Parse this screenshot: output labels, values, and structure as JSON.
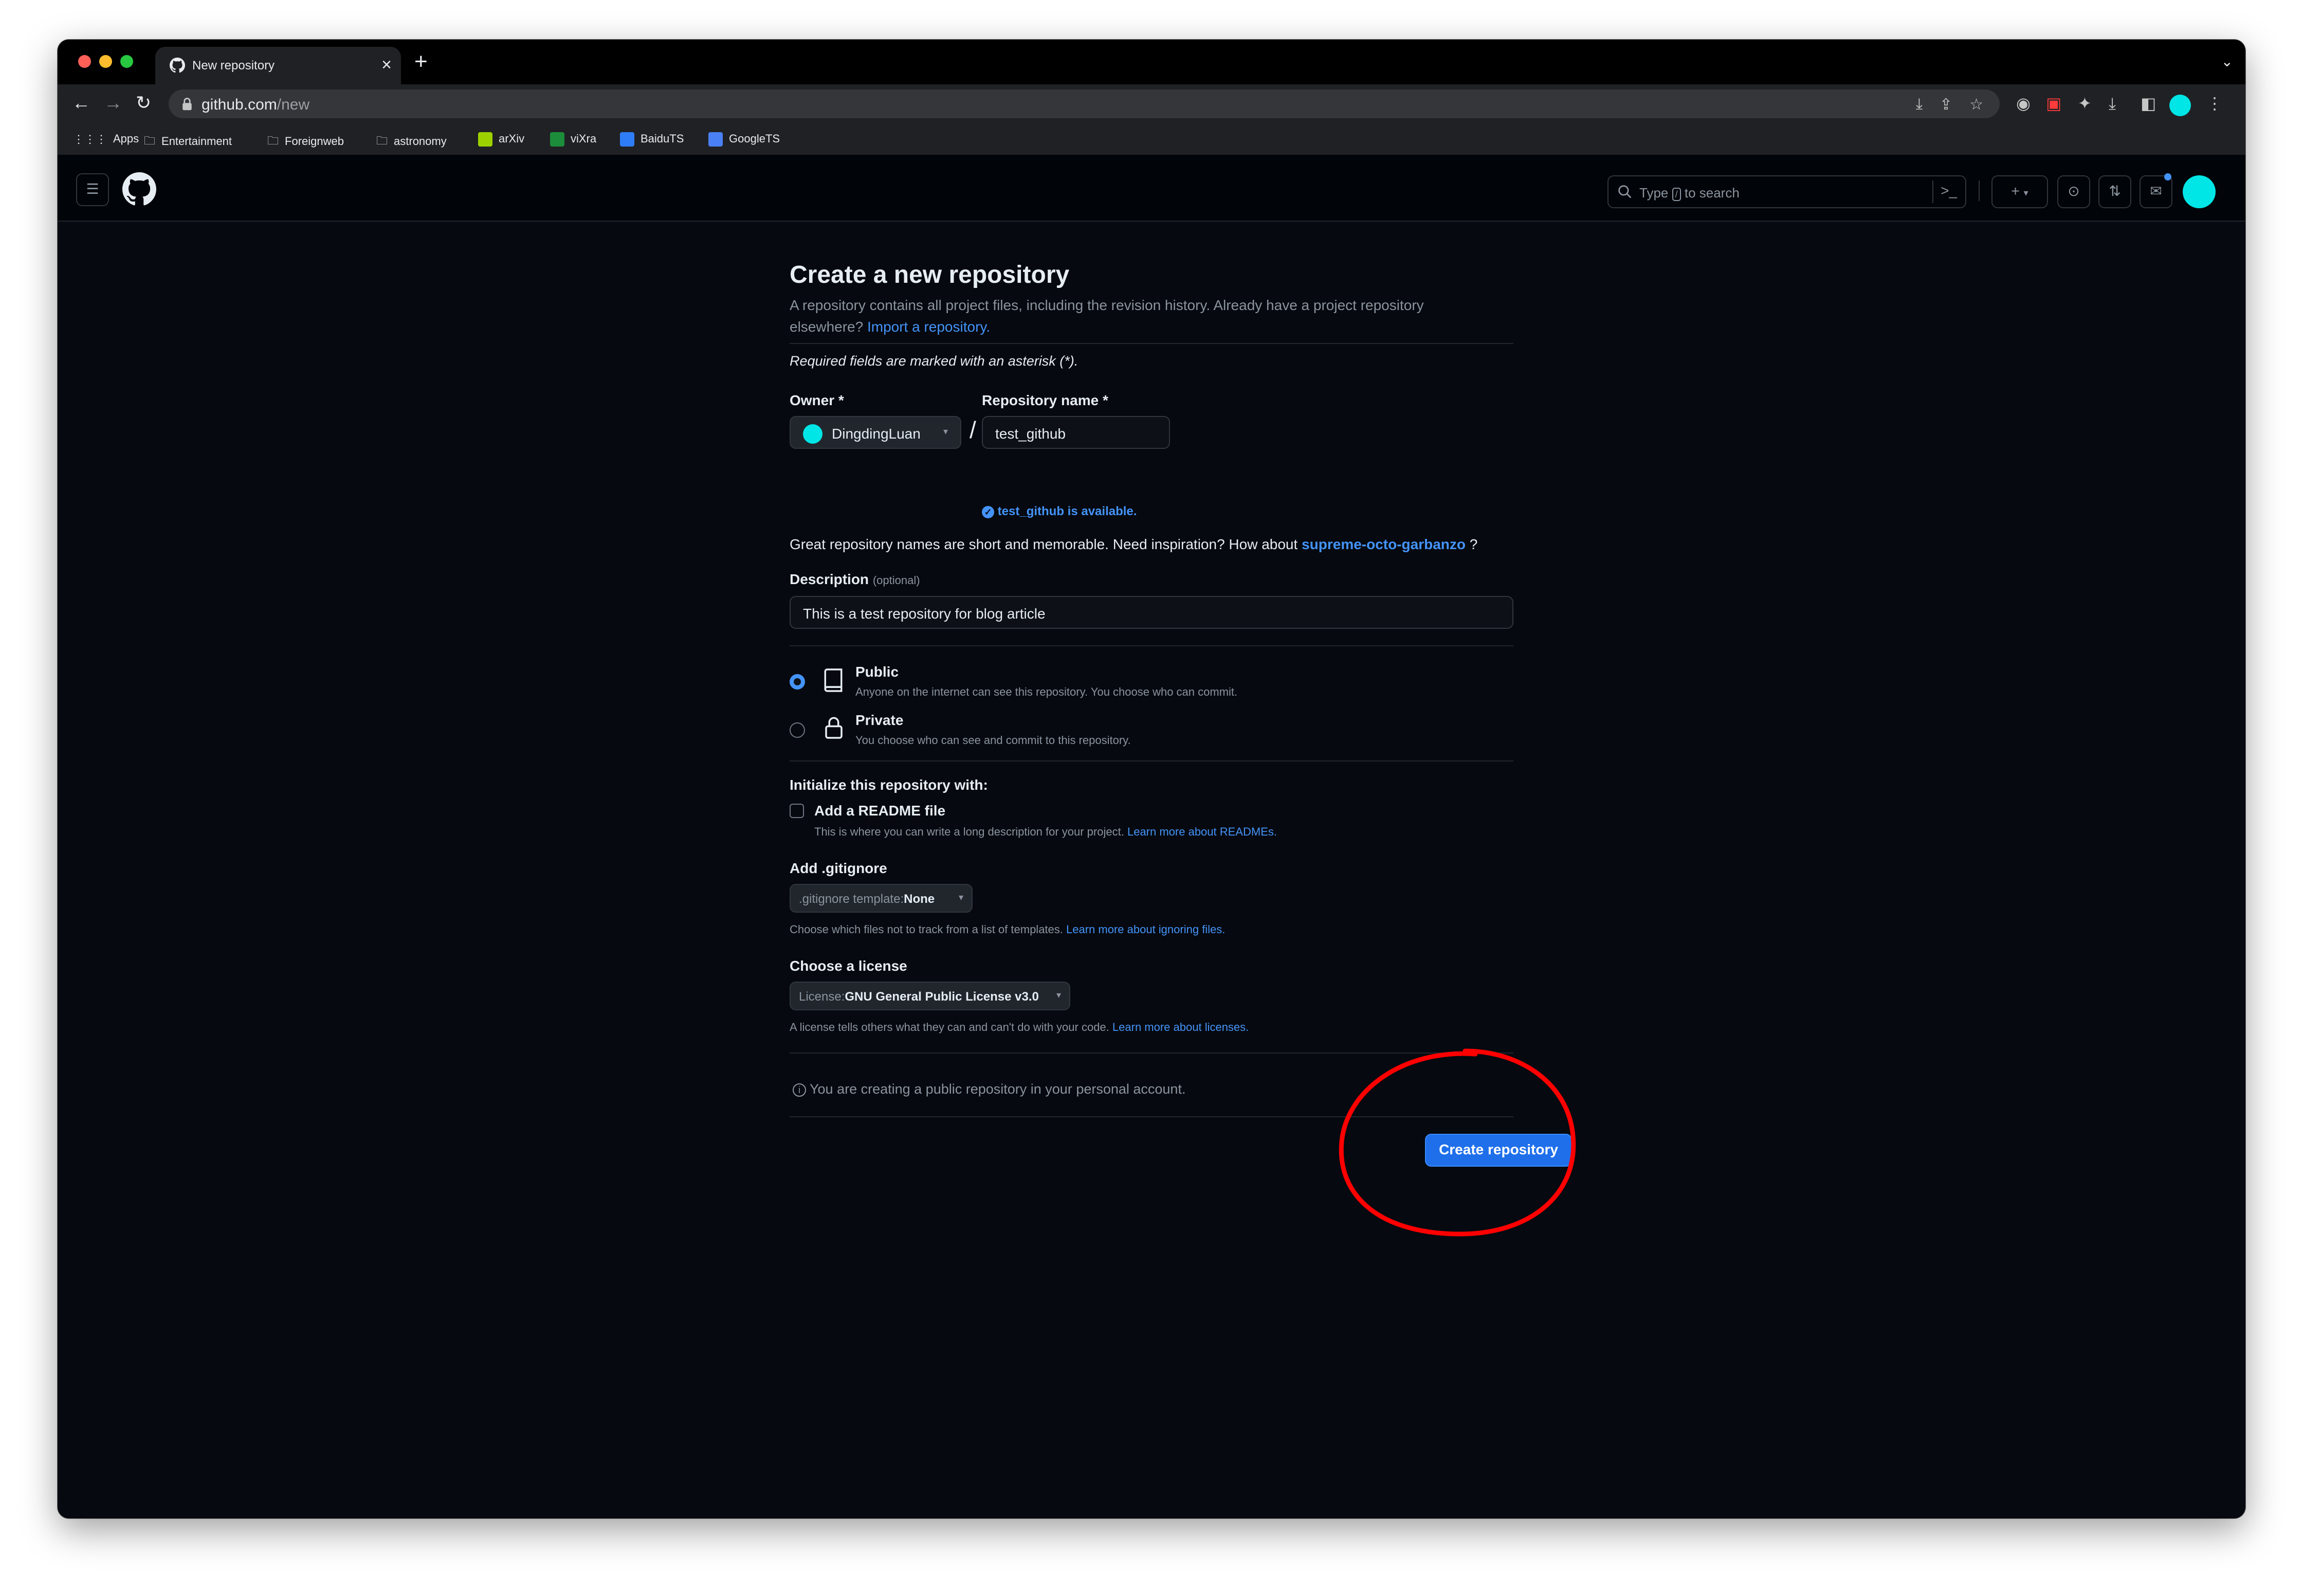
{
  "browser": {
    "tab_title": "New repository",
    "url_host": "github.com",
    "url_path": "/new",
    "bookmarks": [
      "Apps",
      "Entertainment",
      "Foreignweb",
      "astronomy",
      "arXiv",
      "viXra",
      "BaiduTS",
      "GoogleTS"
    ],
    "bookmark_icons": [
      "apps-grid-icon",
      "folder-icon",
      "folder-icon",
      "folder-icon",
      "arxiv-icon",
      "vixra-icon",
      "baidu-translate-icon",
      "google-translate-icon"
    ]
  },
  "gh_header": {
    "search_prefix": "Type",
    "search_key": "/",
    "search_suffix": "to search"
  },
  "page": {
    "title": "Create a new repository",
    "intro": "A repository contains all project files, including the revision history. Already have a project repository elsewhere?",
    "import_link": "Import a repository.",
    "required_note": "Required fields are marked with an asterisk (*).",
    "owner_label": "Owner *",
    "owner_value": "DingdingLuan",
    "slash": "/",
    "repo_label": "Repository name *",
    "repo_value": "test_github",
    "availability": "test_github is available.",
    "inspiration_text": "Great repository names are short and memorable. Need inspiration? How about",
    "inspiration_name": "supreme-octo-garbanzo",
    "inspiration_q": "?",
    "description_label": "Description",
    "description_optional": "(optional)",
    "description_value": "This is a test repository for blog article",
    "visibility": {
      "selected": "public",
      "public_label": "Public",
      "public_desc": "Anyone on the internet can see this repository. You choose who can commit.",
      "private_label": "Private",
      "private_desc": "You choose who can see and commit to this repository."
    },
    "init_label": "Initialize this repository with:",
    "readme_label": "Add a README file",
    "readme_checked": false,
    "readme_desc": "This is where you can write a long description for your project.",
    "readme_link": "Learn more about READMEs.",
    "gitignore_label": "Add .gitignore",
    "gitignore_prefix": ".gitignore template:",
    "gitignore_value": "None",
    "gitignore_desc": "Choose which files not to track from a list of templates.",
    "gitignore_link": "Learn more about ignoring files.",
    "license_label": "Choose a license",
    "license_prefix": "License:",
    "license_value": "GNU General Public License v3.0",
    "license_desc": "A license tells others what they can and can't do with your code.",
    "license_link": "Learn more about licenses.",
    "info_note": "You are creating a public repository in your personal account.",
    "create_button": "Create repository"
  },
  "colors": {
    "accent": "#1f6feb",
    "link": "#4493f8",
    "annotation": "#ff0000",
    "avatar": "#00e5e5"
  }
}
